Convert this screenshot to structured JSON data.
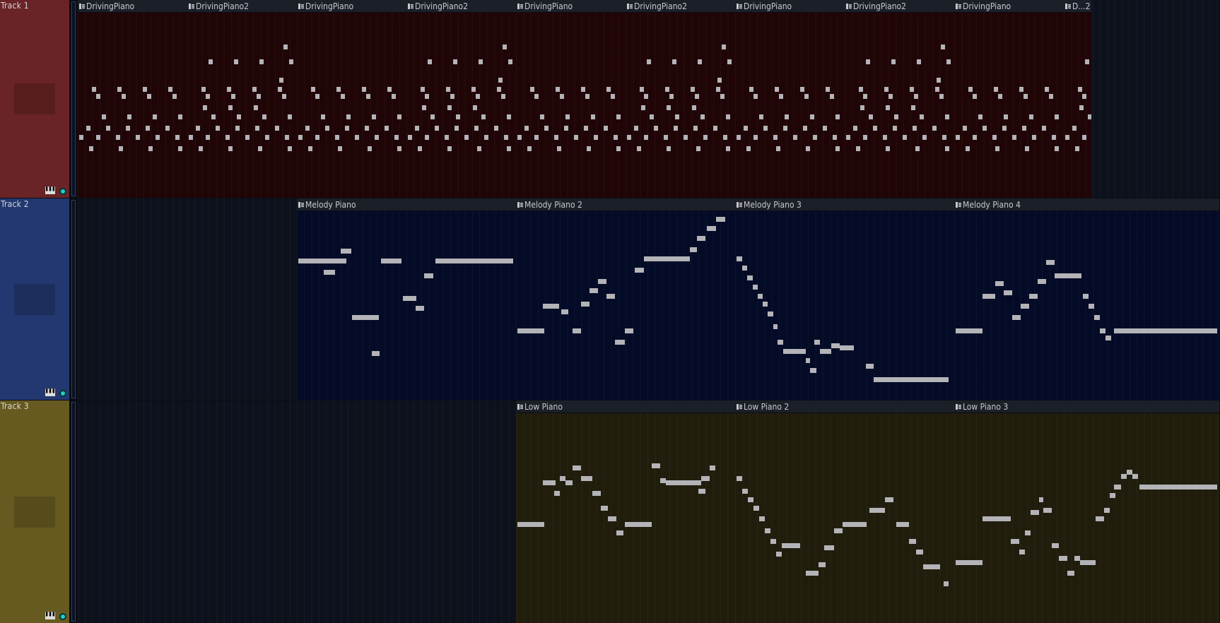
{
  "colors": {
    "track1_header": "#6a2326",
    "track1_clip": "#200507",
    "track2_header": "#233870",
    "track2_clip": "#040b26",
    "track3_header": "#675a20",
    "track3_clip": "#201d0c",
    "empty_lane": "#0d111c",
    "note": "#b4b4b8",
    "status_dot": "#1bd3c8"
  },
  "tracks": [
    {
      "label": "Track 1",
      "icon": "piano-keys-icon",
      "clips": [
        {
          "name": "DrivingPiano",
          "start": 0,
          "length": 155,
          "pattern": "A"
        },
        {
          "name": "DrivingPiano2",
          "start": 155,
          "length": 155,
          "pattern": "B"
        },
        {
          "name": "DrivingPiano",
          "start": 310,
          "length": 155,
          "pattern": "A"
        },
        {
          "name": "DrivingPiano2",
          "start": 465,
          "length": 155,
          "pattern": "B"
        },
        {
          "name": "DrivingPiano",
          "start": 620,
          "length": 155,
          "pattern": "A"
        },
        {
          "name": "DrivingPiano2",
          "start": 775,
          "length": 155,
          "pattern": "B"
        },
        {
          "name": "DrivingPiano",
          "start": 930,
          "length": 155,
          "pattern": "A"
        },
        {
          "name": "DrivingPiano2",
          "start": 1085,
          "length": 155,
          "pattern": "B"
        },
        {
          "name": "DrivingPiano",
          "start": 1240,
          "length": 155,
          "pattern": "A"
        },
        {
          "name": "D...2",
          "start": 1395,
          "length": 39,
          "pattern": "B"
        }
      ]
    },
    {
      "label": "Track 2",
      "icon": "piano-keys-icon",
      "clips": [
        {
          "name": "Melody Piano",
          "start": 310,
          "length": 310,
          "notes": [
            [
              2,
              70,
              0.25
            ],
            [
              38,
              54,
              0.31
            ],
            [
              50,
              61,
              0.25
            ],
            [
              62,
              77,
              0.2
            ],
            [
              78,
              116,
              0.55
            ],
            [
              106,
              117,
              0.74
            ],
            [
              119,
              148,
              0.25
            ],
            [
              132,
              141,
              0.25
            ],
            [
              150,
              169,
              0.45
            ],
            [
              168,
              180,
              0.5
            ],
            [
              180,
              193,
              0.33
            ],
            [
              196,
              306,
              0.25
            ]
          ]
        },
        {
          "name": "Melody Piano 2",
          "start": 620,
          "length": 310,
          "notes": [
            [
              2,
              40,
              0.62
            ],
            [
              38,
              55,
              0.49
            ],
            [
              55,
              60,
              0.49
            ],
            [
              64,
              74,
              0.52
            ],
            [
              80,
              92,
              0.62
            ],
            [
              92,
              104,
              0.48
            ],
            [
              104,
              116,
              0.41
            ],
            [
              116,
              128,
              0.36
            ],
            [
              128,
              140,
              0.44
            ],
            [
              140,
              154,
              0.68
            ],
            [
              154,
              166,
              0.62
            ],
            [
              168,
              181,
              0.3
            ],
            [
              181,
              218,
              0.24
            ],
            [
              218,
              246,
              0.24
            ],
            [
              246,
              256,
              0.19
            ],
            [
              256,
              268,
              0.13
            ],
            [
              270,
              283,
              0.08
            ],
            [
              283,
              296,
              0.03
            ]
          ]
        },
        {
          "name": "Melody Piano 3",
          "start": 930,
          "length": 310,
          "notes": [
            [
              2,
              10,
              0.24
            ],
            [
              10,
              17,
              0.29
            ],
            [
              17,
              25,
              0.34
            ],
            [
              25,
              32,
              0.39
            ],
            [
              32,
              39,
              0.44
            ],
            [
              39,
              46,
              0.48
            ],
            [
              46,
              54,
              0.53
            ],
            [
              54,
              60,
              0.6
            ],
            [
              60,
              68,
              0.68
            ],
            [
              68,
              76,
              0.73
            ],
            [
              76,
              100,
              0.73
            ],
            [
              100,
              106,
              0.78
            ],
            [
              106,
              115,
              0.83
            ],
            [
              112,
              120,
              0.68
            ],
            [
              120,
              136,
              0.73
            ],
            [
              136,
              148,
              0.7
            ],
            [
              148,
              168,
              0.71
            ],
            [
              185,
              196,
              0.81
            ],
            [
              196,
              302,
              0.88
            ]
          ]
        },
        {
          "name": "Melody Piano 4",
          "start": 1240,
          "length": 375,
          "notes": [
            [
              2,
              40,
              0.62
            ],
            [
              40,
              58,
              0.44
            ],
            [
              58,
              70,
              0.37
            ],
            [
              70,
              82,
              0.42
            ],
            [
              82,
              94,
              0.55
            ],
            [
              94,
              106,
              0.49
            ],
            [
              106,
              118,
              0.44
            ],
            [
              118,
              130,
              0.36
            ],
            [
              130,
              142,
              0.26
            ],
            [
              142,
              180,
              0.33
            ],
            [
              182,
              190,
              0.44
            ],
            [
              190,
              198,
              0.49
            ],
            [
              198,
              206,
              0.55
            ],
            [
              206,
              214,
              0.62
            ],
            [
              214,
              222,
              0.66
            ],
            [
              226,
              372,
              0.62
            ]
          ]
        }
      ]
    },
    {
      "label": "Track 3",
      "icon": "piano-keys-icon",
      "clips": [
        {
          "name": "Low Piano",
          "start": 620,
          "length": 310,
          "notes": [
            [
              2,
              40,
              0.52
            ],
            [
              38,
              56,
              0.32
            ],
            [
              54,
              62,
              0.37
            ],
            [
              62,
              70,
              0.3
            ],
            [
              70,
              80,
              0.32
            ],
            [
              80,
              92,
              0.25
            ],
            [
              92,
              108,
              0.3
            ],
            [
              108,
              120,
              0.37
            ],
            [
              120,
              130,
              0.44
            ],
            [
              130,
              142,
              0.49
            ],
            [
              142,
              152,
              0.56
            ],
            [
              154,
              192,
              0.52
            ],
            [
              192,
              204,
              0.24
            ],
            [
              204,
              212,
              0.31
            ],
            [
              212,
              262,
              0.32
            ],
            [
              258,
              268,
              0.36
            ],
            [
              262,
              274,
              0.3
            ],
            [
              274,
              282,
              0.25
            ]
          ]
        },
        {
          "name": "Low Piano 2",
          "start": 930,
          "length": 310,
          "notes": [
            [
              2,
              10,
              0.3
            ],
            [
              10,
              18,
              0.36
            ],
            [
              18,
              26,
              0.4
            ],
            [
              26,
              34,
              0.44
            ],
            [
              34,
              42,
              0.49
            ],
            [
              42,
              50,
              0.55
            ],
            [
              50,
              58,
              0.6
            ],
            [
              58,
              66,
              0.66
            ],
            [
              66,
              92,
              0.62
            ],
            [
              100,
              118,
              0.75
            ],
            [
              118,
              128,
              0.71
            ],
            [
              126,
              140,
              0.63
            ],
            [
              140,
              152,
              0.55
            ],
            [
              152,
              186,
              0.52
            ],
            [
              190,
              212,
              0.45
            ],
            [
              212,
              224,
              0.4
            ],
            [
              228,
              246,
              0.52
            ],
            [
              246,
              256,
              0.6
            ],
            [
              256,
              266,
              0.65
            ],
            [
              266,
              274,
              0.72
            ],
            [
              274,
              290,
              0.72
            ],
            [
              295,
              302,
              0.8
            ]
          ]
        },
        {
          "name": "Low Piano 3",
          "start": 1240,
          "length": 375,
          "notes": [
            [
              2,
              40,
              0.7
            ],
            [
              40,
              80,
              0.49
            ],
            [
              80,
              92,
              0.6
            ],
            [
              92,
              100,
              0.65
            ],
            [
              100,
              108,
              0.56
            ],
            [
              108,
              120,
              0.46
            ],
            [
              120,
              126,
              0.4
            ],
            [
              126,
              138,
              0.45
            ],
            [
              138,
              148,
              0.62
            ],
            [
              148,
              160,
              0.68
            ],
            [
              160,
              170,
              0.75
            ],
            [
              170,
              178,
              0.68
            ],
            [
              178,
              200,
              0.7
            ],
            [
              200,
              212,
              0.49
            ],
            [
              212,
              220,
              0.45
            ],
            [
              220,
              228,
              0.38
            ],
            [
              226,
              236,
              0.34
            ],
            [
              236,
              244,
              0.29
            ],
            [
              244,
              252,
              0.27
            ],
            [
              252,
              260,
              0.29
            ],
            [
              262,
              372,
              0.34
            ]
          ]
        }
      ]
    }
  ]
}
